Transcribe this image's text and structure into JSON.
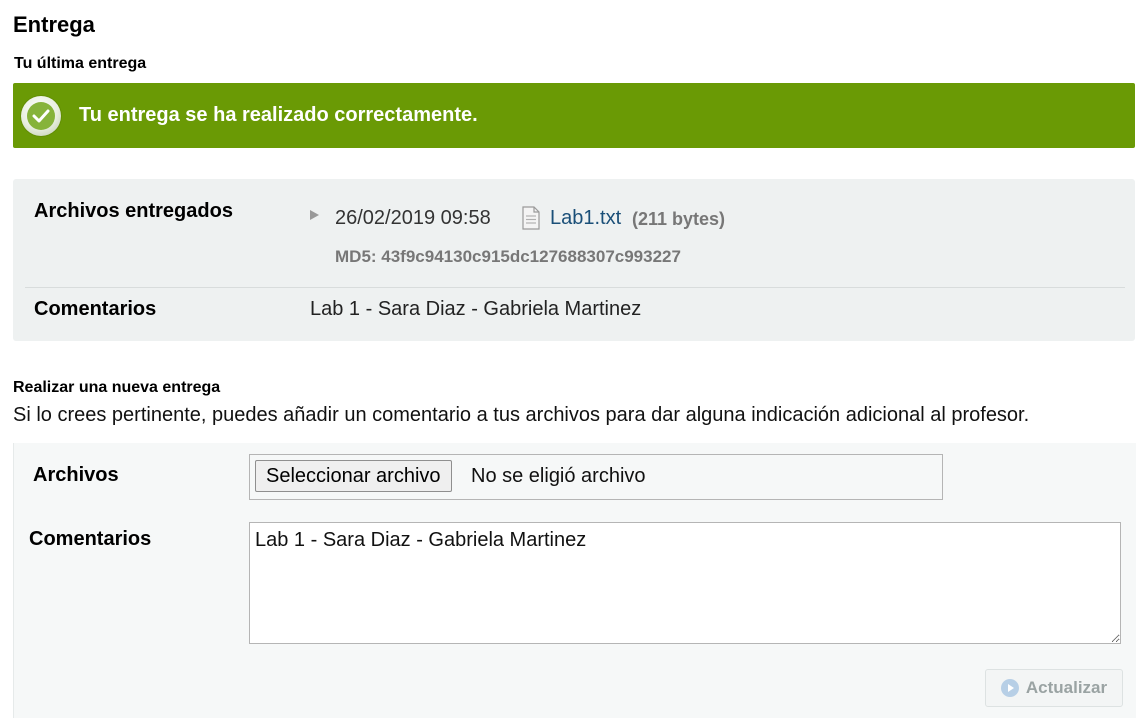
{
  "page": {
    "title": "Entrega",
    "subtitle": "Tu última entrega"
  },
  "success_banner": {
    "message": "Tu entrega se ha realizado correctamente.",
    "icon": "check-circle-icon",
    "color": "#6a9a05"
  },
  "delivered": {
    "files_label": "Archivos entregados",
    "date": "26/02/2019 09:58",
    "file_name": "Lab1.txt",
    "file_size": "(211 bytes)",
    "md5": "MD5: 43f9c94130c915dc127688307c993227",
    "comments_label": "Comentarios",
    "comments_value": "Lab 1 - Sara Diaz - Gabriela Martinez"
  },
  "new_submission": {
    "heading": "Realizar una nueva entrega",
    "intro": "Si lo crees pertinente, puedes añadir un comentario a tus archivos para dar alguna indicación adicional al profesor.",
    "files_label": "Archivos",
    "file_button": "Seleccionar archivo",
    "file_status": "No se eligió archivo",
    "comments_label": "Comentarios",
    "comments_value": "Lab 1 - Sara Diaz - Gabriela Martinez",
    "submit_button": "Actualizar"
  }
}
